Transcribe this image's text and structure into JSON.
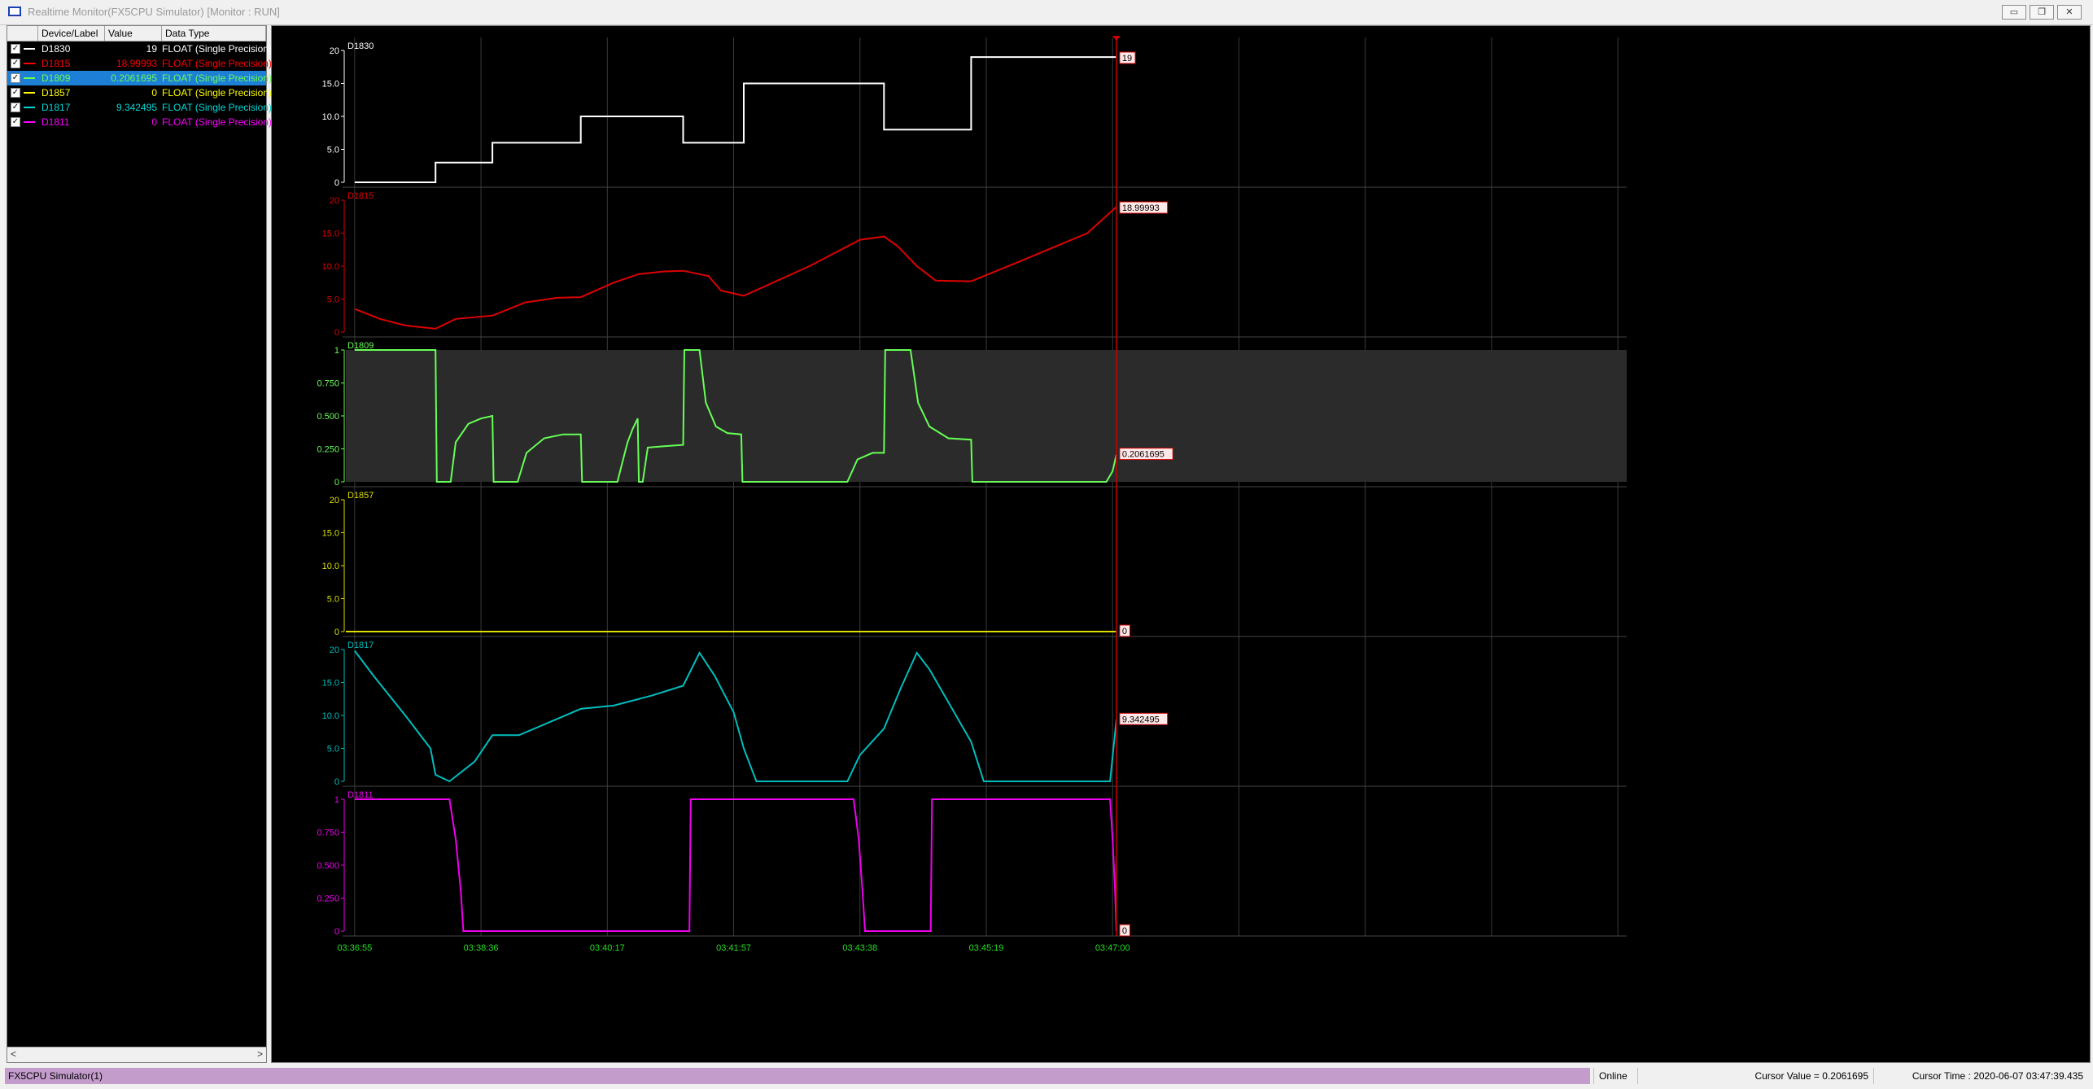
{
  "window": {
    "title": "Realtime Monitor(FX5CPU Simulator) [Monitor : RUN]"
  },
  "window_buttons": {
    "minimize": "▭",
    "restore": "❐",
    "close": "✕"
  },
  "device_list": {
    "columns": [
      "Device/Label",
      "Value",
      "Data Type"
    ],
    "rows": [
      {
        "device": "D1830",
        "value": "19",
        "type": "FLOAT (Single Precision)",
        "color": "#ffffff",
        "checked": true,
        "selected": false
      },
      {
        "device": "D1815",
        "value": "18.99993",
        "type": "FLOAT (Single Precision)",
        "color": "#ff0000",
        "checked": true,
        "selected": false
      },
      {
        "device": "D1809",
        "value": "0.2061695",
        "type": "FLOAT (Single Precision)",
        "color": "#66ff55",
        "checked": true,
        "selected": true
      },
      {
        "device": "D1857",
        "value": "0",
        "type": "FLOAT (Single Precision)",
        "color": "#ffff00",
        "checked": true,
        "selected": false
      },
      {
        "device": "D1817",
        "value": "9.342495",
        "type": "FLOAT (Single Precision)",
        "color": "#00d8d8",
        "checked": true,
        "selected": false
      },
      {
        "device": "D1811",
        "value": "0",
        "type": "FLOAT (Single Precision)",
        "color": "#ff00ff",
        "checked": true,
        "selected": false
      }
    ]
  },
  "chart_data": {
    "type": "line",
    "time_labels": [
      "03:36:55",
      "03:38:36",
      "03:40:17",
      "03:41:57",
      "03:43:38",
      "03:45:19",
      "03:47:00"
    ],
    "cursor_time_index": 6.03,
    "x_extent": [
      -0.07,
      10.07
    ],
    "panels": [
      {
        "name": "D1830",
        "color": "#ffffff",
        "ymax": 20,
        "ticks": [
          "0",
          "5.0",
          "10.0",
          "15.0",
          "20"
        ],
        "cursor_value": "19",
        "points": [
          [
            0,
            0
          ],
          [
            0.64,
            0
          ],
          [
            0.64,
            3
          ],
          [
            1.09,
            3
          ],
          [
            1.09,
            6
          ],
          [
            1.79,
            6
          ],
          [
            1.79,
            10
          ],
          [
            2.6,
            10
          ],
          [
            2.6,
            6
          ],
          [
            3.08,
            6
          ],
          [
            3.08,
            15
          ],
          [
            4.19,
            15
          ],
          [
            4.19,
            8
          ],
          [
            4.88,
            8
          ],
          [
            4.88,
            19
          ],
          [
            6.03,
            19
          ]
        ]
      },
      {
        "name": "D1815",
        "color": "#dd0000",
        "ymax": 20,
        "ticks": [
          "0",
          "5.0",
          "10.0",
          "15.0",
          "20"
        ],
        "cursor_value": "18.99993",
        "points": [
          [
            0,
            3.5
          ],
          [
            0.2,
            2
          ],
          [
            0.4,
            1
          ],
          [
            0.64,
            0.5
          ],
          [
            0.8,
            2
          ],
          [
            1.09,
            2.5
          ],
          [
            1.35,
            4.5
          ],
          [
            1.6,
            5.2
          ],
          [
            1.79,
            5.3
          ],
          [
            2.05,
            7.5
          ],
          [
            2.25,
            8.8
          ],
          [
            2.45,
            9.2
          ],
          [
            2.6,
            9.3
          ],
          [
            2.8,
            8.5
          ],
          [
            2.9,
            6.3
          ],
          [
            3.08,
            5.5
          ],
          [
            3.6,
            10
          ],
          [
            4.0,
            14
          ],
          [
            4.19,
            14.5
          ],
          [
            4.3,
            13
          ],
          [
            4.45,
            10
          ],
          [
            4.6,
            7.8
          ],
          [
            4.88,
            7.7
          ],
          [
            5.3,
            11
          ],
          [
            5.8,
            15
          ],
          [
            6.03,
            18.99993
          ]
        ]
      },
      {
        "name": "D1809",
        "color": "#66ff55",
        "ymax": 1,
        "ticks": [
          "0",
          "0.250",
          "0.500",
          "0.750",
          "1"
        ],
        "cursor_value": "0.2061695",
        "band": [
          0,
          1
        ],
        "points": [
          [
            0,
            1
          ],
          [
            0.64,
            1
          ],
          [
            0.65,
            0
          ],
          [
            0.76,
            0
          ],
          [
            0.8,
            0.3
          ],
          [
            0.9,
            0.44
          ],
          [
            1.0,
            0.48
          ],
          [
            1.09,
            0.5
          ],
          [
            1.1,
            0
          ],
          [
            1.29,
            0
          ],
          [
            1.36,
            0.22
          ],
          [
            1.5,
            0.33
          ],
          [
            1.65,
            0.36
          ],
          [
            1.79,
            0.36
          ],
          [
            1.8,
            0
          ],
          [
            2.08,
            0
          ],
          [
            2.12,
            0.15
          ],
          [
            2.16,
            0.3
          ],
          [
            2.2,
            0.4
          ],
          [
            2.24,
            0.48
          ],
          [
            2.25,
            0
          ],
          [
            2.28,
            0
          ],
          [
            2.32,
            0.26
          ],
          [
            2.45,
            0.27
          ],
          [
            2.6,
            0.28
          ],
          [
            2.61,
            1
          ],
          [
            2.73,
            1
          ],
          [
            2.78,
            0.6
          ],
          [
            2.86,
            0.42
          ],
          [
            2.95,
            0.37
          ],
          [
            3.06,
            0.36
          ],
          [
            3.07,
            0
          ],
          [
            3.9,
            0
          ],
          [
            3.98,
            0.17
          ],
          [
            4.1,
            0.22
          ],
          [
            4.19,
            0.22
          ],
          [
            4.2,
            1
          ],
          [
            4.4,
            1
          ],
          [
            4.46,
            0.6
          ],
          [
            4.55,
            0.42
          ],
          [
            4.7,
            0.33
          ],
          [
            4.88,
            0.32
          ],
          [
            4.89,
            0
          ],
          [
            5.95,
            0
          ],
          [
            6.0,
            0.08
          ],
          [
            6.03,
            0.2061695
          ]
        ]
      },
      {
        "name": "D1857",
        "color": "#dddd00",
        "ymax": 20,
        "ticks": [
          "0",
          "5.0",
          "10.0",
          "15.0",
          "20"
        ],
        "cursor_value": "0",
        "points": [
          [
            -0.07,
            0
          ],
          [
            6.03,
            0
          ]
        ]
      },
      {
        "name": "D1817",
        "color": "#00bdbd",
        "ymax": 20,
        "ticks": [
          "0",
          "5.0",
          "10.0",
          "15.0",
          "20"
        ],
        "cursor_value": "9.342495",
        "points": [
          [
            0,
            19.8
          ],
          [
            0.15,
            16
          ],
          [
            0.4,
            10
          ],
          [
            0.6,
            5
          ],
          [
            0.64,
            1
          ],
          [
            0.75,
            0
          ],
          [
            0.95,
            3
          ],
          [
            1.09,
            7
          ],
          [
            1.3,
            7
          ],
          [
            1.79,
            11
          ],
          [
            2.05,
            11.5
          ],
          [
            2.35,
            13
          ],
          [
            2.6,
            14.5
          ],
          [
            2.73,
            19.5
          ],
          [
            2.85,
            16
          ],
          [
            3.0,
            10.5
          ],
          [
            3.08,
            5
          ],
          [
            3.18,
            0
          ],
          [
            3.9,
            0
          ],
          [
            4.0,
            4
          ],
          [
            4.19,
            8
          ],
          [
            4.32,
            14
          ],
          [
            4.45,
            19.5
          ],
          [
            4.55,
            17
          ],
          [
            4.7,
            12
          ],
          [
            4.88,
            6
          ],
          [
            4.98,
            0
          ],
          [
            5.98,
            0
          ],
          [
            6.03,
            9.342495
          ]
        ]
      },
      {
        "name": "D1811",
        "color": "#ee00ee",
        "ymax": 1,
        "ticks": [
          "0",
          "0.250",
          "0.500",
          "0.750",
          "1"
        ],
        "cursor_value": "0",
        "points": [
          [
            0,
            1
          ],
          [
            0.75,
            1
          ],
          [
            0.8,
            0.7
          ],
          [
            0.84,
            0.3
          ],
          [
            0.86,
            0
          ],
          [
            2.65,
            0
          ],
          [
            2.66,
            1
          ],
          [
            3.95,
            1
          ],
          [
            3.99,
            0.7
          ],
          [
            4.02,
            0.3
          ],
          [
            4.04,
            0
          ],
          [
            4.56,
            0
          ],
          [
            4.57,
            1
          ],
          [
            5.98,
            1
          ],
          [
            6.0,
            0.7
          ],
          [
            6.02,
            0.3
          ],
          [
            6.03,
            0
          ]
        ]
      }
    ]
  },
  "status": {
    "plc": "FX5CPU Simulator(1)",
    "online": "Online",
    "cursor_value": "Cursor Value = 0.2061695",
    "cursor_time": "Cursor Time : 2020-06-07 03:47:39.435"
  }
}
